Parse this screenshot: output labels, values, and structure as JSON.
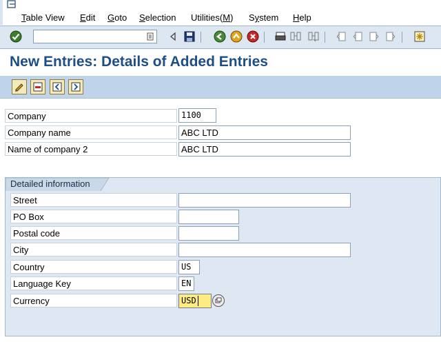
{
  "menubar": {
    "items": [
      {
        "label": "Table View",
        "u": "T",
        "rest": "able View"
      },
      {
        "label": "Edit",
        "u": "E",
        "rest": "dit"
      },
      {
        "label": "Goto",
        "u": "G",
        "rest": "oto"
      },
      {
        "label": "Selection",
        "u": "S",
        "rest": "election"
      },
      {
        "label": "Utilities(M)",
        "pre": "Utilities(",
        "u": "M",
        "rest": ")"
      },
      {
        "label": "System",
        "pre": "S",
        "u": "y",
        "rest": "stem"
      },
      {
        "label": "Help",
        "u": "H",
        "rest": "elp"
      }
    ]
  },
  "toolbar": {
    "command_value": "",
    "icons": [
      "enter-icon",
      "command-dropdown-icon",
      "back-arrow-icon",
      "save-icon",
      "back-icon",
      "exit-icon",
      "cancel-icon",
      "print-icon",
      "find-icon",
      "find-next-icon",
      "first-page-icon",
      "previous-page-icon",
      "next-page-icon",
      "last-page-icon",
      "create-session-icon"
    ]
  },
  "title": "New Entries: Details of Added Entries",
  "app_toolbar": {
    "icons": [
      "display-change-icon",
      "delete-icon",
      "previous-entry-icon",
      "next-entry-icon"
    ]
  },
  "header_fields": [
    {
      "label": "Company",
      "value": "1100"
    },
    {
      "label": "Company name",
      "value": "ABC LTD"
    },
    {
      "label": "Name of company 2",
      "value": "ABC LTD"
    }
  ],
  "detail": {
    "title": "Detailed information",
    "fields": [
      {
        "label": "Street",
        "value": ""
      },
      {
        "label": "PO Box",
        "value": ""
      },
      {
        "label": "Postal code",
        "value": ""
      },
      {
        "label": "City",
        "value": ""
      },
      {
        "label": "Country",
        "value": "US"
      },
      {
        "label": "Language Key",
        "value": "EN"
      },
      {
        "label": "Currency",
        "value": "USD"
      }
    ]
  },
  "colors": {
    "title": "#1d4e86",
    "toolbar_bg": "#dde7f2",
    "app_toolbar_bg": "#bfd3ea",
    "group_bg": "#dfe8f2",
    "focus_field": "#ffec80"
  }
}
